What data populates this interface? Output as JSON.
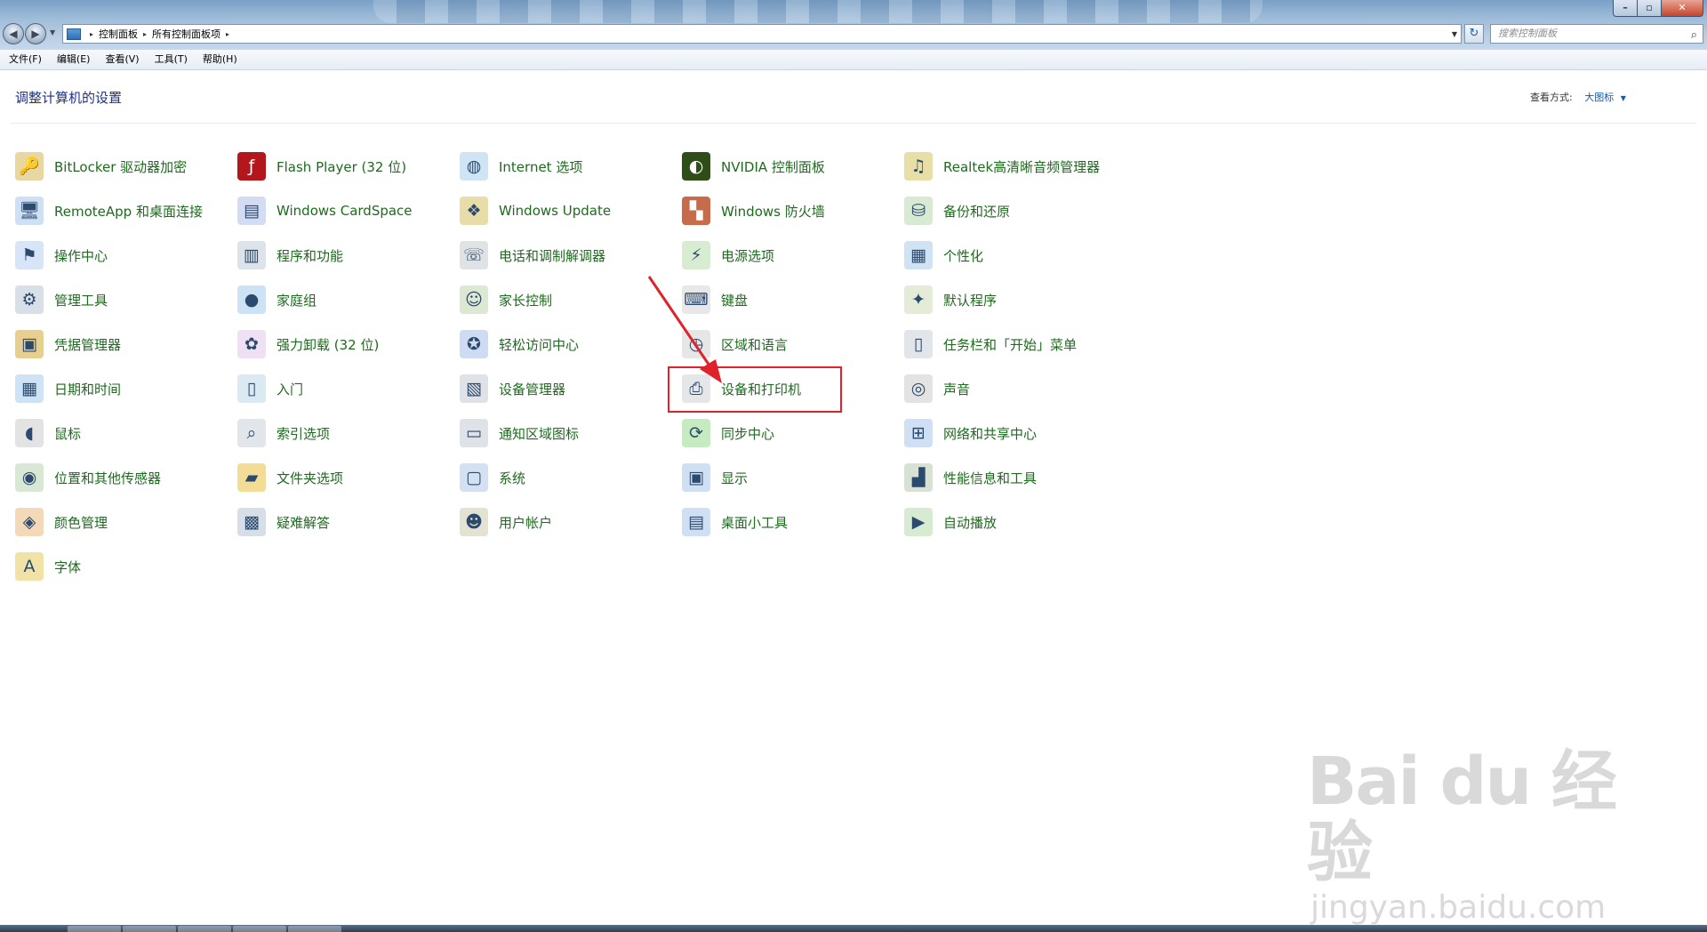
{
  "window": {
    "controls": {
      "minimize": "–",
      "maximize": "▫",
      "close": "✕"
    }
  },
  "nav": {
    "back": "◀",
    "forward": "▶",
    "dropdown": "▼"
  },
  "address": {
    "breadcrumbs": [
      "控制面板",
      "所有控制面板项"
    ],
    "separator": "▸",
    "dropdown": "▼",
    "refresh": "↻"
  },
  "search": {
    "placeholder": "搜索控制面板",
    "icon": "⌕"
  },
  "menu": [
    "文件(F)",
    "编辑(E)",
    "查看(V)",
    "工具(T)",
    "帮助(H)"
  ],
  "page": {
    "title": "调整计算机的设置",
    "view_label": "查看方式:",
    "view_value": "大图标",
    "view_arrow": "▼"
  },
  "items": [
    [
      {
        "label": "BitLocker 驱动器加密",
        "icon": "key-icon"
      },
      {
        "label": "RemoteApp 和桌面连接",
        "icon": "remote-desktop-icon"
      },
      {
        "label": "操作中心",
        "icon": "flag-icon"
      },
      {
        "label": "管理工具",
        "icon": "admin-tools-icon"
      },
      {
        "label": "凭据管理器",
        "icon": "vault-icon"
      },
      {
        "label": "日期和时间",
        "icon": "calendar-icon"
      },
      {
        "label": "鼠标",
        "icon": "mouse-icon"
      },
      {
        "label": "位置和其他传感器",
        "icon": "sensor-icon"
      },
      {
        "label": "颜色管理",
        "icon": "color-management-icon"
      },
      {
        "label": "字体",
        "icon": "font-icon"
      }
    ],
    [
      {
        "label": "Flash Player (32 位)",
        "icon": "flash-icon"
      },
      {
        "label": "Windows CardSpace",
        "icon": "cardspace-icon"
      },
      {
        "label": "程序和功能",
        "icon": "programs-icon"
      },
      {
        "label": "家庭组",
        "icon": "homegroup-icon"
      },
      {
        "label": "强力卸载 (32 位)",
        "icon": "uninstaller-icon"
      },
      {
        "label": "入门",
        "icon": "getting-started-icon"
      },
      {
        "label": "索引选项",
        "icon": "indexing-icon"
      },
      {
        "label": "文件夹选项",
        "icon": "folder-options-icon"
      },
      {
        "label": "疑难解答",
        "icon": "troubleshoot-icon"
      }
    ],
    [
      {
        "label": "Internet 选项",
        "icon": "globe-icon"
      },
      {
        "label": "Windows Update",
        "icon": "windows-update-icon"
      },
      {
        "label": "电话和调制解调器",
        "icon": "phone-icon"
      },
      {
        "label": "家长控制",
        "icon": "parental-control-icon"
      },
      {
        "label": "轻松访问中心",
        "icon": "ease-of-access-icon"
      },
      {
        "label": "设备管理器",
        "icon": "device-manager-icon"
      },
      {
        "label": "通知区域图标",
        "icon": "notification-icon"
      },
      {
        "label": "系统",
        "icon": "system-icon"
      },
      {
        "label": "用户帐户",
        "icon": "user-accounts-icon"
      }
    ],
    [
      {
        "label": "NVIDIA 控制面板",
        "icon": "nvidia-icon"
      },
      {
        "label": "Windows 防火墙",
        "icon": "firewall-icon"
      },
      {
        "label": "电源选项",
        "icon": "power-icon"
      },
      {
        "label": "键盘",
        "icon": "keyboard-icon"
      },
      {
        "label": "区域和语言",
        "icon": "region-icon"
      },
      {
        "label": "设备和打印机",
        "icon": "printer-icon"
      },
      {
        "label": "同步中心",
        "icon": "sync-icon"
      },
      {
        "label": "显示",
        "icon": "display-icon"
      },
      {
        "label": "桌面小工具",
        "icon": "gadgets-icon"
      }
    ],
    [
      {
        "label": "Realtek高清晰音频管理器",
        "icon": "audio-manager-icon"
      },
      {
        "label": "备份和还原",
        "icon": "backup-icon"
      },
      {
        "label": "个性化",
        "icon": "personalization-icon"
      },
      {
        "label": "默认程序",
        "icon": "default-programs-icon"
      },
      {
        "label": "任务栏和「开始」菜单",
        "icon": "taskbar-icon"
      },
      {
        "label": "声音",
        "icon": "speaker-icon"
      },
      {
        "label": "网络和共享中心",
        "icon": "network-icon"
      },
      {
        "label": "性能信息和工具",
        "icon": "performance-icon"
      },
      {
        "label": "自动播放",
        "icon": "autoplay-icon"
      }
    ]
  ],
  "watermark": {
    "main": "Bai du 经验",
    "sub": "jingyan.baidu.com"
  }
}
